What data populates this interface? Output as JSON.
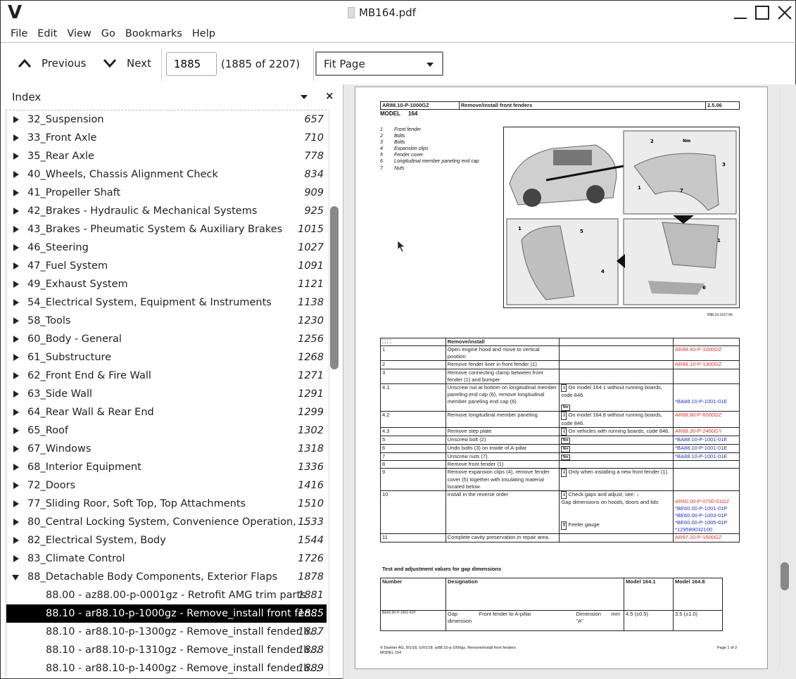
{
  "window": {
    "title": "MB164.pdf",
    "logo": "V"
  },
  "menu": [
    "File",
    "Edit",
    "View",
    "Go",
    "Bookmarks",
    "Help"
  ],
  "toolbar": {
    "previous": "Previous",
    "next": "Next",
    "page_value": "1885",
    "page_count": "(1885 of 2207)",
    "zoom": "Fit Page"
  },
  "index": {
    "title": "Index",
    "items": [
      {
        "label": "32_Suspension",
        "page": "657"
      },
      {
        "label": "33_Front Axle",
        "page": "710"
      },
      {
        "label": "35_Rear Axle",
        "page": "778"
      },
      {
        "label": "40_Wheels, Chassis Alignment Check",
        "page": "834"
      },
      {
        "label": "41_Propeller Shaft",
        "page": "909"
      },
      {
        "label": "42_Brakes - Hydraulic & Mechanical Systems",
        "page": "925"
      },
      {
        "label": "43_Brakes - Pheumatic System & Auxiliary Brakes",
        "page": "1015"
      },
      {
        "label": "46_Steering",
        "page": "1027"
      },
      {
        "label": "47_Fuel System",
        "page": "1091"
      },
      {
        "label": "49_Exhaust System",
        "page": "1121"
      },
      {
        "label": "54_Electrical System, Equipment & Instruments",
        "page": "1138"
      },
      {
        "label": "58_Tools",
        "page": "1230"
      },
      {
        "label": "60_Body - General",
        "page": "1256"
      },
      {
        "label": "61_Substructure",
        "page": "1268"
      },
      {
        "label": "62_Front End & Fire Wall",
        "page": "1271"
      },
      {
        "label": "63_Side Wall",
        "page": "1291"
      },
      {
        "label": "64_Rear Wall & Rear End",
        "page": "1299"
      },
      {
        "label": "65_Roof",
        "page": "1302"
      },
      {
        "label": "67_Windows",
        "page": "1318"
      },
      {
        "label": "68_Interior Equipment",
        "page": "1336"
      },
      {
        "label": "72_Doors",
        "page": "1416"
      },
      {
        "label": "77_Sliding Roor, Soft Top, Top Attachments",
        "page": "1510"
      },
      {
        "label": "80_Central Locking System, Convenience Operation, ...",
        "page": "1533"
      },
      {
        "label": "82_Electrical System, Body",
        "page": "1544"
      },
      {
        "label": "83_Climate Control",
        "page": "1726"
      },
      {
        "label": "88_Detachable Body Components, Exterior Flaps",
        "page": "1878",
        "expanded": true
      },
      {
        "label": "88.00 - az88.00-p-0001gz - Retrofit AMG trim parts",
        "page": "1881",
        "child": true
      },
      {
        "label": "88.10 - ar88.10-p-1000gz - Remove_install front fen...",
        "page": "1885",
        "child": true,
        "selected": true
      },
      {
        "label": "88.10 - ar88.10-p-1300gz - Remove_install fender li...",
        "page": "1887",
        "child": true
      },
      {
        "label": "88.10 - ar88.10-p-1310gz - Remove_install fender li...",
        "page": "1888",
        "child": true
      },
      {
        "label": "88.10 - ar88.10-p-1400gz - Remove_install fender li...",
        "page": "1889",
        "child": true
      }
    ]
  },
  "doc": {
    "code": "AR88.10-P-1000GZ",
    "heading": "Remove/install front fenders",
    "version": "2.5.06",
    "model_label": "MODEL",
    "model": "164",
    "legend": [
      [
        "1",
        "Front fender"
      ],
      [
        "2",
        "Bolts"
      ],
      [
        "3",
        "Bolts"
      ],
      [
        "4",
        "Expansion clips"
      ],
      [
        "5",
        "Fender cover"
      ],
      [
        "6",
        "Longitudinal member paneling end cap"
      ],
      [
        "7",
        "Nuts"
      ]
    ],
    "figure_id": "P88.10-2167-06",
    "callouts": [
      "1",
      "2",
      "3",
      "7",
      "Nm",
      "1",
      "5",
      "4",
      "1",
      "6"
    ],
    "table_header": "Remove/install",
    "steps": [
      {
        "n": "1",
        "text": "Open engine hood and move to vertical position",
        "note": "",
        "ref": [
          [
            "AR88.40-P-1000GZ",
            "red"
          ]
        ]
      },
      {
        "n": "2",
        "text": "Remove fender liner in front fender (1)",
        "note": "",
        "ref": [
          [
            "AR88.10-P-1300GZ",
            "red"
          ]
        ]
      },
      {
        "n": "3",
        "text": "Remove connecting clamp between front fender (1) and bumper",
        "note": "",
        "ref": []
      },
      {
        "n": "4.1",
        "text": "Unscrew nut at bottom on longitudinal member paneling end cap (6), remove longitudinal member paneling end cap (6)",
        "note": "On model 164.1 without running boards, code 846.",
        "nm": true,
        "ref": [
          [
            "*BA88.10-P-1001-01E",
            "blue"
          ]
        ]
      },
      {
        "n": "4.2",
        "text": "Remove longitudinal member paneling",
        "note": "On model 164.8 without running boards, code 846.",
        "ref": [
          [
            "AR88.80-P-6000GZ",
            "red"
          ]
        ]
      },
      {
        "n": "4.3",
        "text": "Remove step plate",
        "note": "On vehicles with running boards, code 846.",
        "ref": [
          [
            "AR88.30-P-2400GY",
            "red"
          ]
        ]
      },
      {
        "n": "5",
        "text": "Unscrew bolt (2)",
        "nmonly": true,
        "ref": [
          [
            "*BA88.10-P-1001-01E",
            "blue"
          ]
        ]
      },
      {
        "n": "6",
        "text": "Undo bolts (3) on inside of A-pillar",
        "nmonly": true,
        "ref": [
          [
            "*BA88.10-P-1001-01E",
            "blue"
          ]
        ]
      },
      {
        "n": "7",
        "text": "Unscrew nuts (7).",
        "nmonly": true,
        "ref": [
          [
            "*BA88.10-P-1001-01E",
            "blue"
          ]
        ]
      },
      {
        "n": "8",
        "text": "Remove front fender (1)",
        "note": "",
        "ref": []
      },
      {
        "n": "9",
        "text": "Remove expansion clips (4), remove fender cover (5) together with insulating material located below.",
        "note": "Only when installing a new front fender (1).",
        "ref": []
      },
      {
        "n": "10",
        "text": "Install in the reverse order",
        "note": "Check gaps and adjust, see: ↓",
        "note2": "Gap dimensions on hoods, doors and lids",
        "tool": "Feeler gauge",
        "ref": [
          [
            "AR60.00-P-0700-01GZ",
            "red"
          ],
          [
            "*BE60.00-P-1001-01P",
            "blue"
          ],
          [
            "*BE60.00-P-1003-01P",
            "blue"
          ],
          [
            "*BE60.00-P-1005-01P",
            "blue"
          ],
          [
            "*129589032100",
            "blue"
          ]
        ]
      },
      {
        "n": "11",
        "text": "Complete cavity preservation in repair area.",
        "note": "",
        "ref": [
          [
            "AR97.20-P-1500GZ",
            "red"
          ]
        ]
      }
    ],
    "gap_title": "Test and adjustment values for gap dimensions",
    "gap_headers": [
      "Number",
      "Designation",
      "Model 164.1",
      "Model 164.8"
    ],
    "gap_row": {
      "number": "BE60.00-P-1001-01P",
      "type": "Gap dimension",
      "desc": "Front fender to A-pillar",
      "dim": "Dimension \"A\"",
      "unit": "mm",
      "m1": "4.5 (±0.5)",
      "m2": "3.5 (±1.0)"
    },
    "footer": "© Daimler AG, 8/1/18, G/01/18, ar88.10-p-1000gz, Remove/install front fenders",
    "footer2": "MODEL 164",
    "page_of": "Page 1 of 2"
  }
}
